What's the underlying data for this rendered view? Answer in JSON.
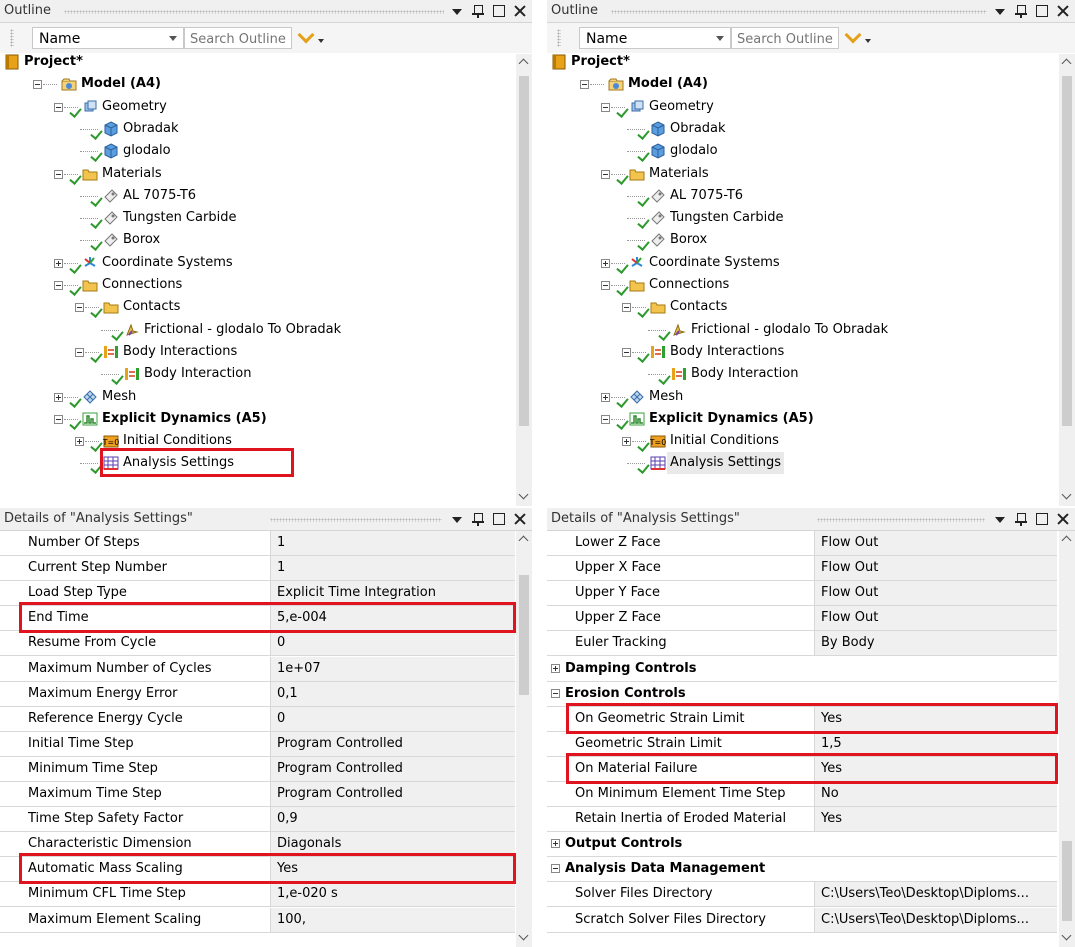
{
  "outline": {
    "title": "Outline",
    "name_label": "Name",
    "search_placeholder": "Search Outline",
    "tree": {
      "project": "Project*",
      "model": "Model (A4)",
      "geometry": "Geometry",
      "obradak": "Obradak",
      "glodalo": "glodalo",
      "materials": "Materials",
      "al7075": "AL 7075-T6",
      "tungsten": "Tungsten Carbide",
      "borox": "Borox",
      "coordinate_systems": "Coordinate Systems",
      "connections": "Connections",
      "contacts": "Contacts",
      "frictional": "Frictional - glodalo To Obradak",
      "body_interactions": "Body Interactions",
      "body_interaction": "Body Interaction",
      "mesh": "Mesh",
      "explicit_dynamics": "Explicit Dynamics (A5)",
      "initial_conditions": "Initial Conditions",
      "analysis_settings": "Analysis Settings"
    }
  },
  "details": {
    "title": "Details of \"Analysis Settings\"",
    "left_rows": [
      {
        "key": "Number Of Steps",
        "value": "1"
      },
      {
        "key": "Current Step Number",
        "value": "1"
      },
      {
        "key": "Load Step Type",
        "value": "Explicit Time Integration"
      },
      {
        "key": "End Time",
        "value": "5,e-004"
      },
      {
        "key": "Resume From Cycle",
        "value": "0"
      },
      {
        "key": "Maximum Number of Cycles",
        "value": "1e+07"
      },
      {
        "key": "Maximum Energy Error",
        "value": "0,1"
      },
      {
        "key": "Reference Energy Cycle",
        "value": "0"
      },
      {
        "key": "Initial Time Step",
        "value": "Program Controlled"
      },
      {
        "key": "Minimum Time Step",
        "value": "Program Controlled"
      },
      {
        "key": "Maximum Time Step",
        "value": "Program Controlled"
      },
      {
        "key": "Time Step Safety Factor",
        "value": "0,9"
      },
      {
        "key": "Characteristic Dimension",
        "value": "Diagonals"
      },
      {
        "key": "Automatic Mass Scaling",
        "value": "Yes"
      },
      {
        "key": "Minimum CFL Time Step",
        "value": "1,e-020 s"
      },
      {
        "key": "Maximum Element Scaling",
        "value": "100,"
      }
    ],
    "right_rows": [
      {
        "key": "Lower Z Face",
        "value": "Flow Out"
      },
      {
        "key": "Upper X Face",
        "value": "Flow Out"
      },
      {
        "key": "Upper Y Face",
        "value": "Flow Out"
      },
      {
        "key": "Upper Z Face",
        "value": "Flow Out"
      },
      {
        "key": "Euler Tracking",
        "value": "By Body"
      },
      {
        "section": "Damping Controls",
        "state": "plus"
      },
      {
        "section": "Erosion Controls",
        "state": "minus"
      },
      {
        "key": "On Geometric Strain Limit",
        "value": "Yes"
      },
      {
        "key": "Geometric Strain Limit",
        "value": "1,5"
      },
      {
        "key": "On Material Failure",
        "value": "Yes"
      },
      {
        "key": "On Minimum Element Time Step",
        "value": "No"
      },
      {
        "key": "Retain Inertia of Eroded Material",
        "value": "Yes"
      },
      {
        "section": "Output Controls",
        "state": "plus"
      },
      {
        "section": "Analysis Data Management",
        "state": "minus"
      },
      {
        "key": "Solver Files Directory",
        "value": "C:\\Users\\Teo\\Desktop\\Diploms..."
      },
      {
        "key": "Scratch Solver Files Directory",
        "value": "C:\\Users\\Teo\\Desktop\\Diploms..."
      }
    ]
  },
  "colors": {
    "highlight": "#e0141e",
    "check": "#2e9a2e",
    "value_bg": "#f0f0f0"
  }
}
